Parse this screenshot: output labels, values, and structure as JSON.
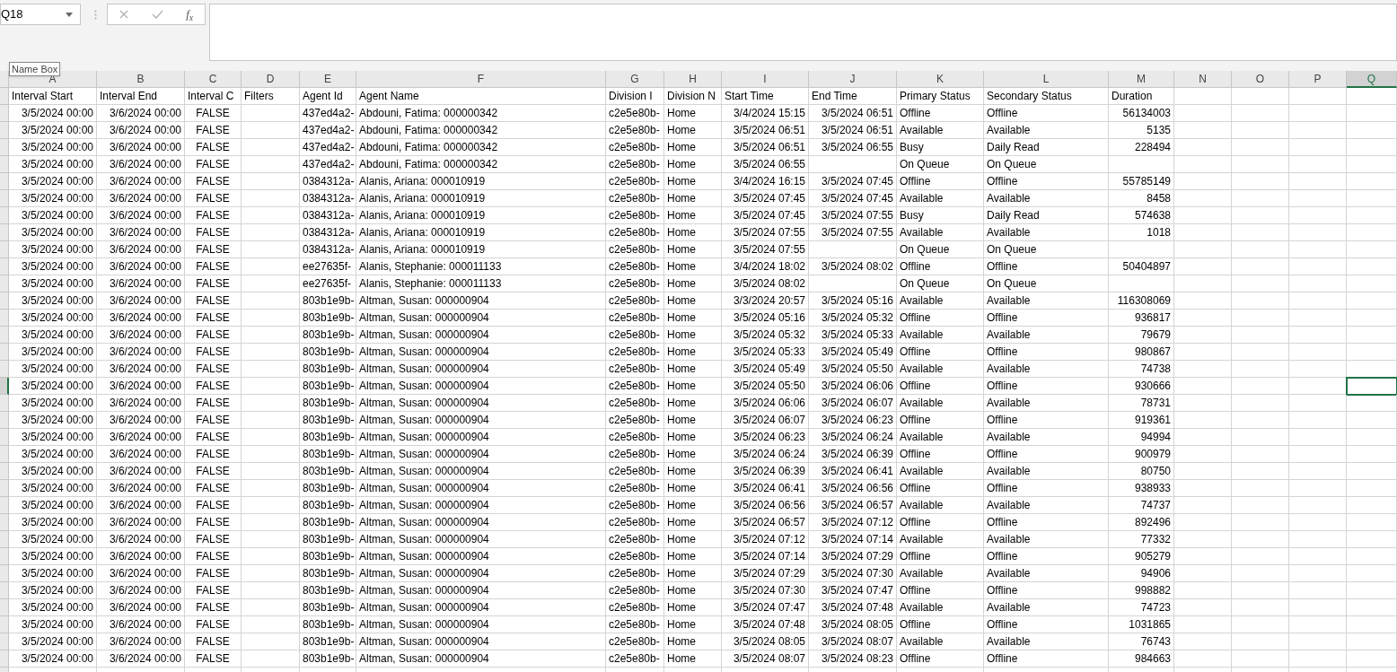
{
  "name_box": {
    "value": "Q18",
    "tooltip": "Name Box"
  },
  "formula_bar": {
    "function_label": "f$_{x}$"
  },
  "columns": [
    {
      "letter": "A",
      "heading": "Interval Start",
      "selected": false
    },
    {
      "letter": "B",
      "heading": "Interval End",
      "selected": false
    },
    {
      "letter": "C",
      "heading": "Interval C",
      "selected": false
    },
    {
      "letter": "D",
      "heading": "Filters",
      "selected": false
    },
    {
      "letter": "E",
      "heading": "Agent Id",
      "selected": false
    },
    {
      "letter": "F",
      "heading": "Agent Name",
      "selected": false
    },
    {
      "letter": "G",
      "heading": "Division I",
      "selected": false
    },
    {
      "letter": "H",
      "heading": "Division N",
      "selected": false
    },
    {
      "letter": "I",
      "heading": "Start Time",
      "selected": false
    },
    {
      "letter": "J",
      "heading": "End Time",
      "selected": false
    },
    {
      "letter": "K",
      "heading": "Primary Status",
      "selected": false
    },
    {
      "letter": "L",
      "heading": "Secondary Status",
      "selected": false
    },
    {
      "letter": "M",
      "heading": "Duration",
      "selected": false
    },
    {
      "letter": "N",
      "selected": false
    },
    {
      "letter": "O",
      "selected": false
    },
    {
      "letter": "P",
      "selected": false
    },
    {
      "letter": "Q",
      "selected": true
    }
  ],
  "rows": [
    {
      "selected": false,
      "a": "3/5/2024 00:00",
      "b": "3/6/2024 00:00",
      "c": "FALSE",
      "e": "437ed4a2-",
      "f": "Abdouni, Fatima: 000000342",
      "g": "c2e5e80b-",
      "h": "Home",
      "i": "3/4/2024 15:15",
      "j": "3/5/2024 06:51",
      "k": "Offline",
      "l": "Offline",
      "m": "56134003"
    },
    {
      "selected": false,
      "a": "3/5/2024 00:00",
      "b": "3/6/2024 00:00",
      "c": "FALSE",
      "e": "437ed4a2-",
      "f": "Abdouni, Fatima: 000000342",
      "g": "c2e5e80b-",
      "h": "Home",
      "i": "3/5/2024 06:51",
      "j": "3/5/2024 06:51",
      "k": "Available",
      "l": "Available",
      "m": "5135"
    },
    {
      "selected": false,
      "a": "3/5/2024 00:00",
      "b": "3/6/2024 00:00",
      "c": "FALSE",
      "e": "437ed4a2-",
      "f": "Abdouni, Fatima: 000000342",
      "g": "c2e5e80b-",
      "h": "Home",
      "i": "3/5/2024 06:51",
      "j": "3/5/2024 06:55",
      "k": "Busy",
      "l": "Daily Read",
      "m": "228494"
    },
    {
      "selected": false,
      "a": "3/5/2024 00:00",
      "b": "3/6/2024 00:00",
      "c": "FALSE",
      "e": "437ed4a2-",
      "f": "Abdouni, Fatima: 000000342",
      "g": "c2e5e80b-",
      "h": "Home",
      "i": "3/5/2024 06:55",
      "k": "On Queue",
      "l": "On Queue"
    },
    {
      "selected": false,
      "a": "3/5/2024 00:00",
      "b": "3/6/2024 00:00",
      "c": "FALSE",
      "e": "0384312a-",
      "f": "Alanis, Ariana: 000010919",
      "g": "c2e5e80b-",
      "h": "Home",
      "i": "3/4/2024 16:15",
      "j": "3/5/2024 07:45",
      "k": "Offline",
      "l": "Offline",
      "m": "55785149"
    },
    {
      "selected": false,
      "a": "3/5/2024 00:00",
      "b": "3/6/2024 00:00",
      "c": "FALSE",
      "e": "0384312a-",
      "f": "Alanis, Ariana: 000010919",
      "g": "c2e5e80b-",
      "h": "Home",
      "i": "3/5/2024 07:45",
      "j": "3/5/2024 07:45",
      "k": "Available",
      "l": "Available",
      "m": "8458"
    },
    {
      "selected": false,
      "a": "3/5/2024 00:00",
      "b": "3/6/2024 00:00",
      "c": "FALSE",
      "e": "0384312a-",
      "f": "Alanis, Ariana: 000010919",
      "g": "c2e5e80b-",
      "h": "Home",
      "i": "3/5/2024 07:45",
      "j": "3/5/2024 07:55",
      "k": "Busy",
      "l": "Daily Read",
      "m": "574638"
    },
    {
      "selected": false,
      "a": "3/5/2024 00:00",
      "b": "3/6/2024 00:00",
      "c": "FALSE",
      "e": "0384312a-",
      "f": "Alanis, Ariana: 000010919",
      "g": "c2e5e80b-",
      "h": "Home",
      "i": "3/5/2024 07:55",
      "j": "3/5/2024 07:55",
      "k": "Available",
      "l": "Available",
      "m": "1018"
    },
    {
      "selected": false,
      "a": "3/5/2024 00:00",
      "b": "3/6/2024 00:00",
      "c": "FALSE",
      "e": "0384312a-",
      "f": "Alanis, Ariana: 000010919",
      "g": "c2e5e80b-",
      "h": "Home",
      "i": "3/5/2024 07:55",
      "k": "On Queue",
      "l": "On Queue"
    },
    {
      "selected": false,
      "a": "3/5/2024 00:00",
      "b": "3/6/2024 00:00",
      "c": "FALSE",
      "e": "ee27635f-",
      "f": "Alanis, Stephanie: 000011133",
      "g": "c2e5e80b-",
      "h": "Home",
      "i": "3/4/2024 18:02",
      "j": "3/5/2024 08:02",
      "k": "Offline",
      "l": "Offline",
      "m": "50404897"
    },
    {
      "selected": false,
      "a": "3/5/2024 00:00",
      "b": "3/6/2024 00:00",
      "c": "FALSE",
      "e": "ee27635f-",
      "f": "Alanis, Stephanie: 000011133",
      "g": "c2e5e80b-",
      "h": "Home",
      "i": "3/5/2024 08:02",
      "k": "On Queue",
      "l": "On Queue"
    },
    {
      "selected": false,
      "a": "3/5/2024 00:00",
      "b": "3/6/2024 00:00",
      "c": "FALSE",
      "e": "803b1e9b-",
      "f": "Altman, Susan: 000000904",
      "g": "c2e5e80b-",
      "h": "Home",
      "i": "3/3/2024 20:57",
      "j": "3/5/2024 05:16",
      "k": "Available",
      "l": "Available",
      "m": "116308069"
    },
    {
      "selected": false,
      "a": "3/5/2024 00:00",
      "b": "3/6/2024 00:00",
      "c": "FALSE",
      "e": "803b1e9b-",
      "f": "Altman, Susan: 000000904",
      "g": "c2e5e80b-",
      "h": "Home",
      "i": "3/5/2024 05:16",
      "j": "3/5/2024 05:32",
      "k": "Offline",
      "l": "Offline",
      "m": "936817"
    },
    {
      "selected": false,
      "a": "3/5/2024 00:00",
      "b": "3/6/2024 00:00",
      "c": "FALSE",
      "e": "803b1e9b-",
      "f": "Altman, Susan: 000000904",
      "g": "c2e5e80b-",
      "h": "Home",
      "i": "3/5/2024 05:32",
      "j": "3/5/2024 05:33",
      "k": "Available",
      "l": "Available",
      "m": "79679"
    },
    {
      "selected": false,
      "a": "3/5/2024 00:00",
      "b": "3/6/2024 00:00",
      "c": "FALSE",
      "e": "803b1e9b-",
      "f": "Altman, Susan: 000000904",
      "g": "c2e5e80b-",
      "h": "Home",
      "i": "3/5/2024 05:33",
      "j": "3/5/2024 05:49",
      "k": "Offline",
      "l": "Offline",
      "m": "980867"
    },
    {
      "selected": false,
      "a": "3/5/2024 00:00",
      "b": "3/6/2024 00:00",
      "c": "FALSE",
      "e": "803b1e9b-",
      "f": "Altman, Susan: 000000904",
      "g": "c2e5e80b-",
      "h": "Home",
      "i": "3/5/2024 05:49",
      "j": "3/5/2024 05:50",
      "k": "Available",
      "l": "Available",
      "m": "74738"
    },
    {
      "selected": true,
      "a": "3/5/2024 00:00",
      "b": "3/6/2024 00:00",
      "c": "FALSE",
      "e": "803b1e9b-",
      "f": "Altman, Susan: 000000904",
      "g": "c2e5e80b-",
      "h": "Home",
      "i": "3/5/2024 05:50",
      "j": "3/5/2024 06:06",
      "k": "Offline",
      "l": "Offline",
      "m": "930666"
    },
    {
      "selected": false,
      "a": "3/5/2024 00:00",
      "b": "3/6/2024 00:00",
      "c": "FALSE",
      "e": "803b1e9b-",
      "f": "Altman, Susan: 000000904",
      "g": "c2e5e80b-",
      "h": "Home",
      "i": "3/5/2024 06:06",
      "j": "3/5/2024 06:07",
      "k": "Available",
      "l": "Available",
      "m": "78731"
    },
    {
      "selected": false,
      "a": "3/5/2024 00:00",
      "b": "3/6/2024 00:00",
      "c": "FALSE",
      "e": "803b1e9b-",
      "f": "Altman, Susan: 000000904",
      "g": "c2e5e80b-",
      "h": "Home",
      "i": "3/5/2024 06:07",
      "j": "3/5/2024 06:23",
      "k": "Offline",
      "l": "Offline",
      "m": "919361"
    },
    {
      "selected": false,
      "a": "3/5/2024 00:00",
      "b": "3/6/2024 00:00",
      "c": "FALSE",
      "e": "803b1e9b-",
      "f": "Altman, Susan: 000000904",
      "g": "c2e5e80b-",
      "h": "Home",
      "i": "3/5/2024 06:23",
      "j": "3/5/2024 06:24",
      "k": "Available",
      "l": "Available",
      "m": "94994"
    },
    {
      "selected": false,
      "a": "3/5/2024 00:00",
      "b": "3/6/2024 00:00",
      "c": "FALSE",
      "e": "803b1e9b-",
      "f": "Altman, Susan: 000000904",
      "g": "c2e5e80b-",
      "h": "Home",
      "i": "3/5/2024 06:24",
      "j": "3/5/2024 06:39",
      "k": "Offline",
      "l": "Offline",
      "m": "900979"
    },
    {
      "selected": false,
      "a": "3/5/2024 00:00",
      "b": "3/6/2024 00:00",
      "c": "FALSE",
      "e": "803b1e9b-",
      "f": "Altman, Susan: 000000904",
      "g": "c2e5e80b-",
      "h": "Home",
      "i": "3/5/2024 06:39",
      "j": "3/5/2024 06:41",
      "k": "Available",
      "l": "Available",
      "m": "80750"
    },
    {
      "selected": false,
      "a": "3/5/2024 00:00",
      "b": "3/6/2024 00:00",
      "c": "FALSE",
      "e": "803b1e9b-",
      "f": "Altman, Susan: 000000904",
      "g": "c2e5e80b-",
      "h": "Home",
      "i": "3/5/2024 06:41",
      "j": "3/5/2024 06:56",
      "k": "Offline",
      "l": "Offline",
      "m": "938933"
    },
    {
      "selected": false,
      "a": "3/5/2024 00:00",
      "b": "3/6/2024 00:00",
      "c": "FALSE",
      "e": "803b1e9b-",
      "f": "Altman, Susan: 000000904",
      "g": "c2e5e80b-",
      "h": "Home",
      "i": "3/5/2024 06:56",
      "j": "3/5/2024 06:57",
      "k": "Available",
      "l": "Available",
      "m": "74737"
    },
    {
      "selected": false,
      "a": "3/5/2024 00:00",
      "b": "3/6/2024 00:00",
      "c": "FALSE",
      "e": "803b1e9b-",
      "f": "Altman, Susan: 000000904",
      "g": "c2e5e80b-",
      "h": "Home",
      "i": "3/5/2024 06:57",
      "j": "3/5/2024 07:12",
      "k": "Offline",
      "l": "Offline",
      "m": "892496"
    },
    {
      "selected": false,
      "a": "3/5/2024 00:00",
      "b": "3/6/2024 00:00",
      "c": "FALSE",
      "e": "803b1e9b-",
      "f": "Altman, Susan: 000000904",
      "g": "c2e5e80b-",
      "h": "Home",
      "i": "3/5/2024 07:12",
      "j": "3/5/2024 07:14",
      "k": "Available",
      "l": "Available",
      "m": "77332"
    },
    {
      "selected": false,
      "a": "3/5/2024 00:00",
      "b": "3/6/2024 00:00",
      "c": "FALSE",
      "e": "803b1e9b-",
      "f": "Altman, Susan: 000000904",
      "g": "c2e5e80b-",
      "h": "Home",
      "i": "3/5/2024 07:14",
      "j": "3/5/2024 07:29",
      "k": "Offline",
      "l": "Offline",
      "m": "905279"
    },
    {
      "selected": false,
      "a": "3/5/2024 00:00",
      "b": "3/6/2024 00:00",
      "c": "FALSE",
      "e": "803b1e9b-",
      "f": "Altman, Susan: 000000904",
      "g": "c2e5e80b-",
      "h": "Home",
      "i": "3/5/2024 07:29",
      "j": "3/5/2024 07:30",
      "k": "Available",
      "l": "Available",
      "m": "94906"
    },
    {
      "selected": false,
      "a": "3/5/2024 00:00",
      "b": "3/6/2024 00:00",
      "c": "FALSE",
      "e": "803b1e9b-",
      "f": "Altman, Susan: 000000904",
      "g": "c2e5e80b-",
      "h": "Home",
      "i": "3/5/2024 07:30",
      "j": "3/5/2024 07:47",
      "k": "Offline",
      "l": "Offline",
      "m": "998882"
    },
    {
      "selected": false,
      "a": "3/5/2024 00:00",
      "b": "3/6/2024 00:00",
      "c": "FALSE",
      "e": "803b1e9b-",
      "f": "Altman, Susan: 000000904",
      "g": "c2e5e80b-",
      "h": "Home",
      "i": "3/5/2024 07:47",
      "j": "3/5/2024 07:48",
      "k": "Available",
      "l": "Available",
      "m": "74723"
    },
    {
      "selected": false,
      "a": "3/5/2024 00:00",
      "b": "3/6/2024 00:00",
      "c": "FALSE",
      "e": "803b1e9b-",
      "f": "Altman, Susan: 000000904",
      "g": "c2e5e80b-",
      "h": "Home",
      "i": "3/5/2024 07:48",
      "j": "3/5/2024 08:05",
      "k": "Offline",
      "l": "Offline",
      "m": "1031865"
    },
    {
      "selected": false,
      "a": "3/5/2024 00:00",
      "b": "3/6/2024 00:00",
      "c": "FALSE",
      "e": "803b1e9b-",
      "f": "Altman, Susan: 000000904",
      "g": "c2e5e80b-",
      "h": "Home",
      "i": "3/5/2024 08:05",
      "j": "3/5/2024 08:07",
      "k": "Available",
      "l": "Available",
      "m": "76743"
    },
    {
      "selected": false,
      "a": "3/5/2024 00:00",
      "b": "3/6/2024 00:00",
      "c": "FALSE",
      "e": "803b1e9b-",
      "f": "Altman, Susan: 000000904",
      "g": "c2e5e80b-",
      "h": "Home",
      "i": "3/5/2024 08:07",
      "j": "3/5/2024 08:23",
      "k": "Offline",
      "l": "Offline",
      "m": "984663"
    }
  ]
}
